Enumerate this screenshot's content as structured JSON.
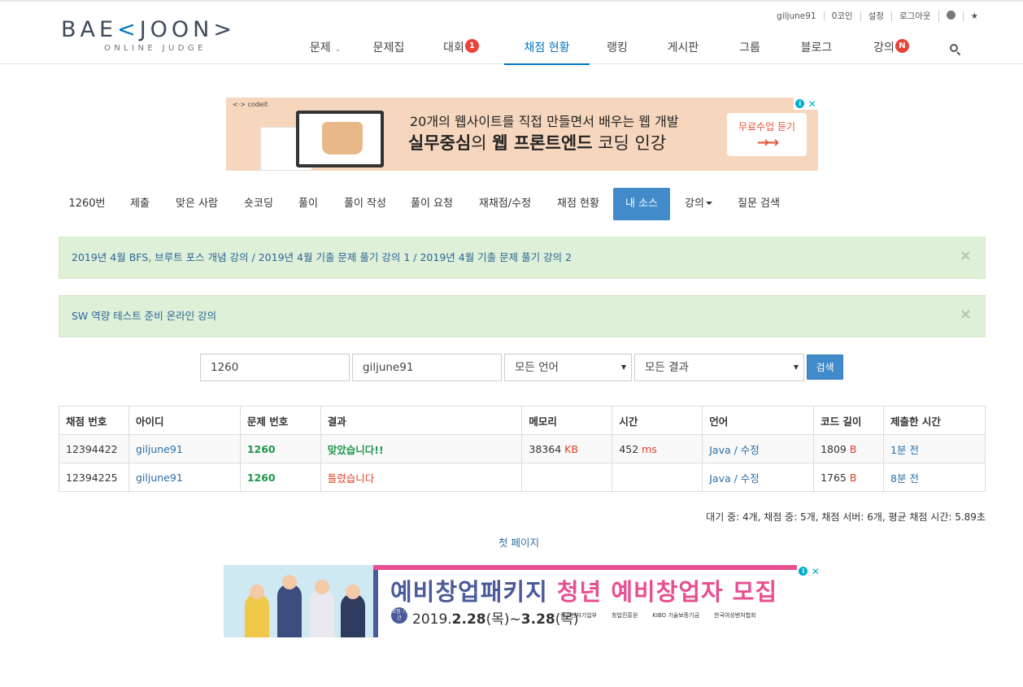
{
  "logo": {
    "main_left": "BAE",
    "main_accent": "<",
    "main_right": "JOON>",
    "sub": "ONLINE JUDGE"
  },
  "userbar": {
    "username": "giljune91",
    "coins": "0코인",
    "settings": "설정",
    "logout": "로그아웃",
    "star": "★"
  },
  "nav": {
    "items": [
      {
        "label": "문제",
        "caret": "⌄"
      },
      {
        "label": "문제집"
      },
      {
        "label": "대회",
        "badge": "1"
      },
      {
        "label": "채점 현황"
      },
      {
        "label": "랭킹"
      },
      {
        "label": "게시판"
      },
      {
        "label": "그룹"
      },
      {
        "label": "블로그"
      },
      {
        "label": "강의",
        "badge": "N"
      }
    ]
  },
  "ad_top": {
    "brand": "<·> codeit",
    "line1": "20개의 웹사이트를 직접 만들면서 배우는 웹 개발",
    "line2_bold1": "실무중심",
    "line2_mid": "의 ",
    "line2_bold2": "웹 프론트엔드",
    "line2_end": " 코딩 인강",
    "cta": "무료수업 듣기",
    "cta_arrows": "→→"
  },
  "problem_tabs": [
    {
      "label": "1260번"
    },
    {
      "label": "제출"
    },
    {
      "label": "맞은 사람"
    },
    {
      "label": "숏코딩"
    },
    {
      "label": "풀이"
    },
    {
      "label": "풀이 작성"
    },
    {
      "label": "풀이 요청"
    },
    {
      "label": "재채점/수정"
    },
    {
      "label": "채점 현황"
    },
    {
      "label": "내 소스"
    },
    {
      "label": "강의"
    },
    {
      "label": "질문 검색"
    }
  ],
  "alerts": [
    {
      "links": [
        "2019년 4월 BFS, 브루트 포스 개념 강의",
        "2019년 4월 기출 문제 풀기 강의 1",
        "2019년 4월 기출 문제 풀기 강의 2"
      ],
      "sep": " / ",
      "close": "×"
    },
    {
      "links": [
        "SW 역량 테스트 준비 온라인 강의"
      ],
      "close": "×"
    }
  ],
  "search": {
    "problem_id": "1260",
    "user_id": "giljune91",
    "language": "모든 언어",
    "result": "모든 결과",
    "button": "검색"
  },
  "table": {
    "headers": [
      "채점 번호",
      "아이디",
      "문제 번호",
      "결과",
      "메모리",
      "시간",
      "언어",
      "코드 길이",
      "제출한 시간"
    ],
    "rows": [
      {
        "id": "12394422",
        "user": "giljune91",
        "problem": "1260",
        "result": "맞았습니다!!",
        "memory": "38364",
        "memory_unit": "KB",
        "time": "452",
        "time_unit": "ms",
        "lang": "Java",
        "lang_sep": " / ",
        "edit": "수정",
        "length": "1809",
        "length_unit": "B",
        "submitted": "1분 전"
      },
      {
        "id": "12394225",
        "user": "giljune91",
        "problem": "1260",
        "result": "틀렸습니다",
        "memory": "",
        "memory_unit": "",
        "time": "",
        "time_unit": "",
        "lang": "Java",
        "lang_sep": " / ",
        "edit": "수정",
        "length": "1765",
        "length_unit": "B",
        "submitted": "8분 전"
      }
    ]
  },
  "stats": "대기 중: 4개, 채점 중: 5개, 채점 서버: 6개, 평균 채점 시간: 5.89초",
  "first_page": "첫 페이지",
  "ad_bottom": {
    "title_a": "예비창업패키지 ",
    "title_b": "청년 예비창업자 모집",
    "tag": "모집 기간",
    "date_a": "2019.",
    "date_b": "2.28",
    "date_c": "(목)~",
    "date_d": "3.28",
    "date_e": "(목)",
    "orgs": [
      "중소벤처기업부",
      "창업진흥원",
      "KIBO 기술보증기금",
      "한국여성벤처협회"
    ]
  },
  "colors": {
    "accent": "#0076c0",
    "tab_active": "#428bca",
    "alert_bg": "#dff0d8",
    "accepted": "#20954c",
    "wrong": "#dd4124"
  }
}
